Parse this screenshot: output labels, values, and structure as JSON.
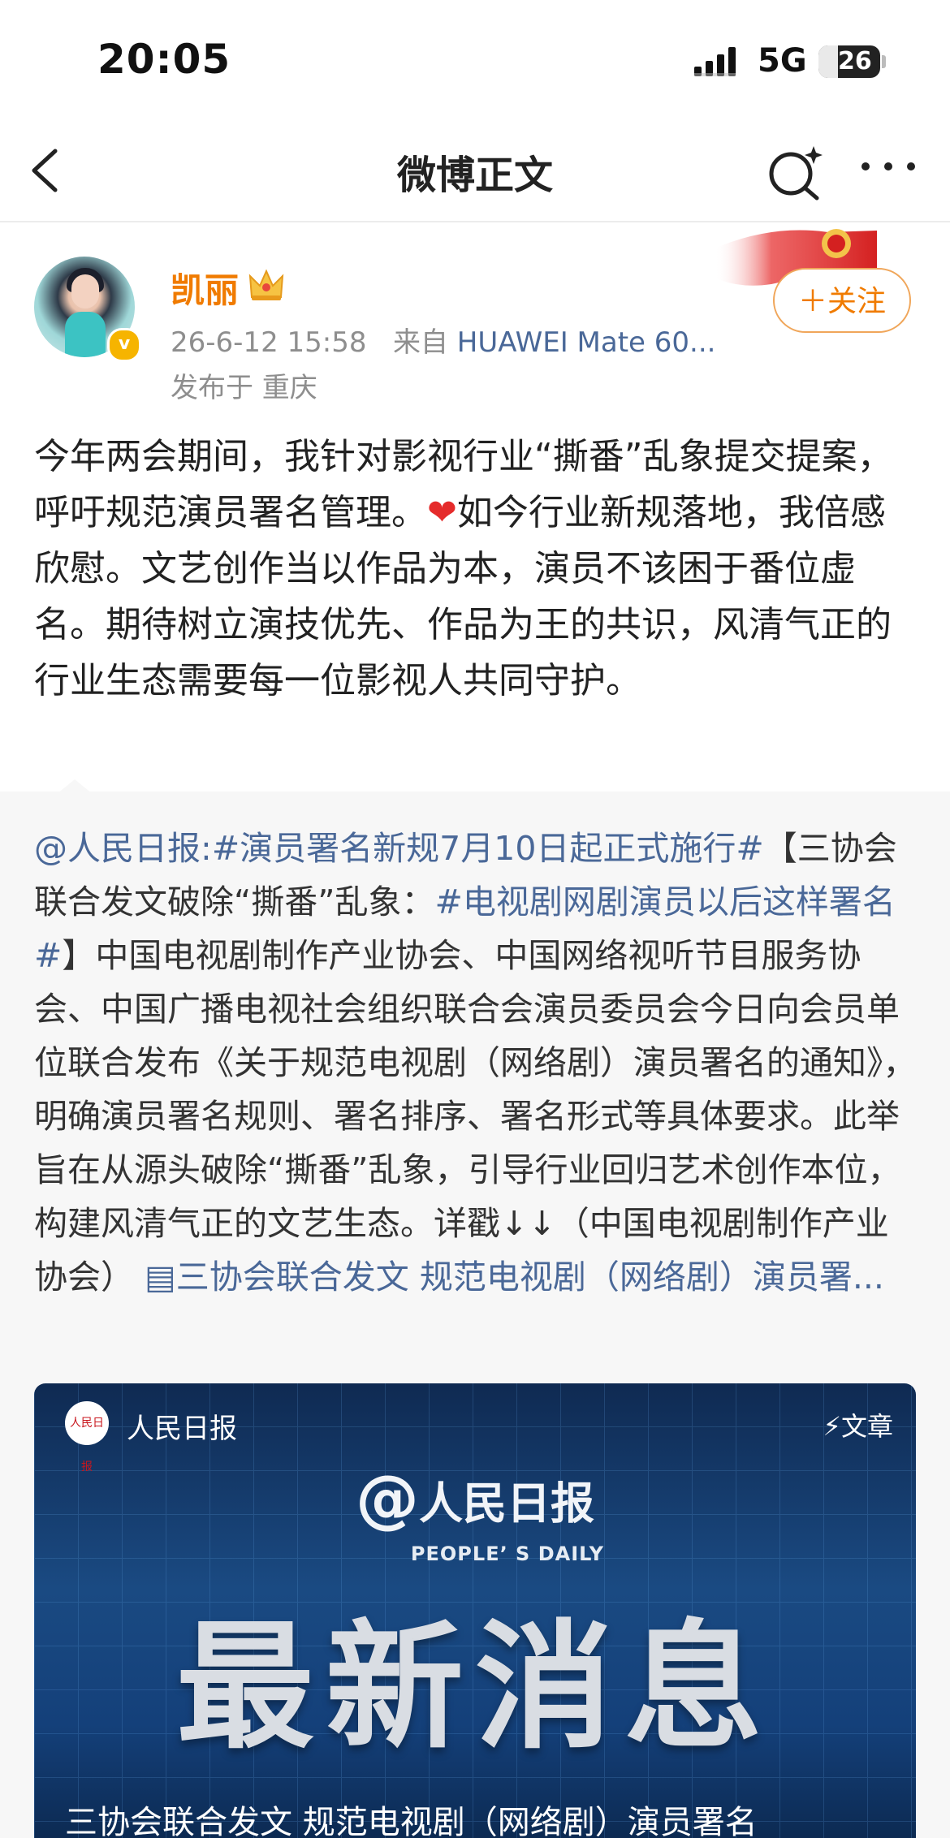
{
  "status_bar": {
    "time": "20:05",
    "network": "5G",
    "battery": "26"
  },
  "nav": {
    "title": "微博正文"
  },
  "post": {
    "username": "凯丽",
    "time": "26-6-12 15:58",
    "from_prefix": "来自",
    "device": "HUAWEI Mate 60...",
    "location": "发布于 重庆",
    "follow_label": "＋关注",
    "text_part1": "今年两会期间，我针对影视行业“撕番”乱象提交提案，呼吁规范演员署名管理。",
    "heart": "❤",
    "text_part2": "如今行业新规落地，我倍感欣慰。文艺创作当以作品为本，演员不该困于番位虚名。期待树立演技优先、作品为王的共识，风清气正的行业生态需要每一位影视人共同守护。"
  },
  "repost": {
    "mention": "@人民日报",
    "colon": ":",
    "topic1": "#演员署名新规7月10日起正式施行#",
    "text1": "【三协会联合发文破除“撕番”乱象：",
    "topic2": "#电视剧网剧演员以后这样署名#",
    "text2": "】中国电视剧制作产业协会、中国网络视听节目服务协会、中国广播电视社会组织联合会演员委员会今日向会员单位联合发布《关于规范电视剧（网络剧）演员署名的通知》，明确演员署名规则、署名排序、署名形式等具体要求。此举旨在从源头破除“撕番”乱象，引导行业回归艺术创作本位，构建风清气正的文艺生态。详戳↓↓（中国电视剧制作产业协会）",
    "article_link": "▤三协会联合发文 规范电视剧（网络剧）演员署..."
  },
  "card": {
    "source": "人民日报",
    "logo_text": "人民日报",
    "type": "⚡文章",
    "brand_at": "@",
    "brand_name": "人民日报",
    "brand_sub": "PEOPLE’ S DAILY",
    "headline": "最新消息",
    "caption": "三协会联合发文 规范电视剧（网络剧）演员署名"
  }
}
